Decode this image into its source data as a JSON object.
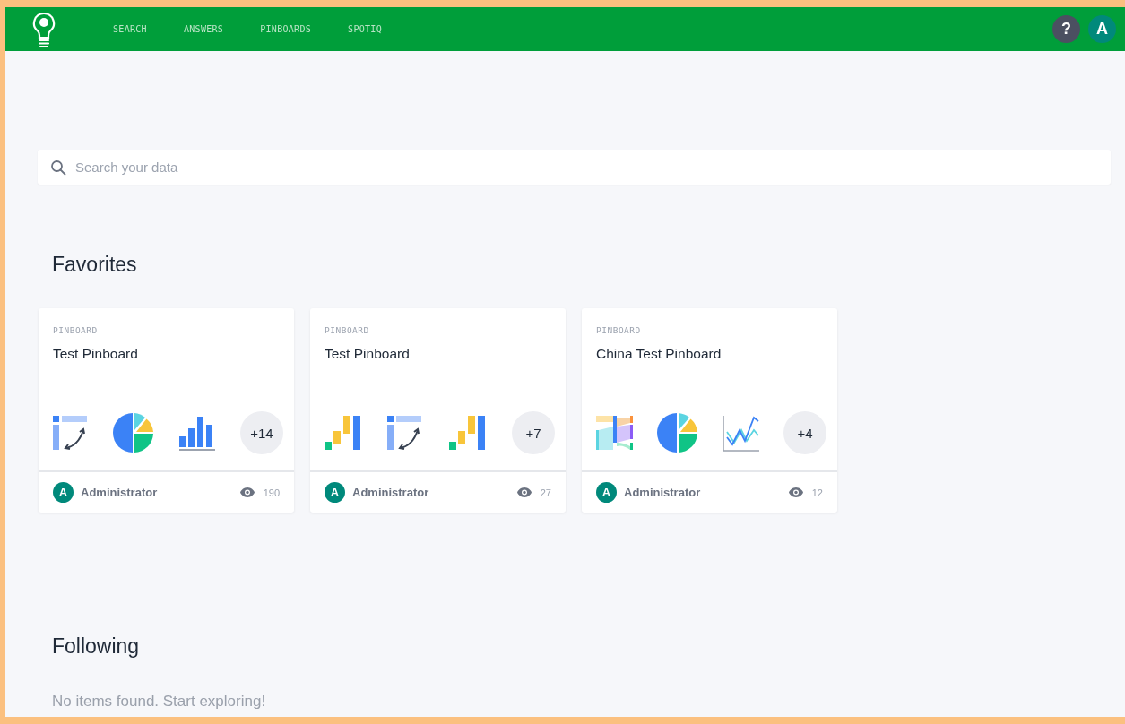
{
  "nav": {
    "items": [
      {
        "label": "SEARCH",
        "selected": false
      },
      {
        "label": "ANSWERS",
        "selected": false
      },
      {
        "label": "PINBOARDS",
        "selected": false
      },
      {
        "label": "SPOTIQ",
        "selected": false
      }
    ],
    "help": "?",
    "avatar": "A"
  },
  "search": {
    "placeholder": "Search your data"
  },
  "favorites": {
    "title": "Favorites",
    "cards": [
      {
        "type": "PINBOARD",
        "title": "Test Pinboard",
        "thumbnails": [
          {
            "kind": "pivot"
          },
          {
            "kind": "pie"
          },
          {
            "kind": "bar"
          }
        ],
        "more": "+14",
        "author_initial": "A",
        "author": "Administrator",
        "views": "190"
      },
      {
        "type": "PINBOARD",
        "title": "Test Pinboard",
        "thumbnails": [
          {
            "kind": "waterfall"
          },
          {
            "kind": "pivot"
          },
          {
            "kind": "waterfall"
          }
        ],
        "more": "+7",
        "author_initial": "A",
        "author": "Administrator",
        "views": "27"
      },
      {
        "type": "PINBOARD",
        "title": "China Test Pinboard",
        "thumbnails": [
          {
            "kind": "sankey"
          },
          {
            "kind": "pie"
          },
          {
            "kind": "line"
          }
        ],
        "more": "+4",
        "author_initial": "A",
        "author": "Administrator",
        "views": "12"
      }
    ]
  },
  "following": {
    "title": "Following",
    "empty": "No items found. Start exploring!"
  }
}
